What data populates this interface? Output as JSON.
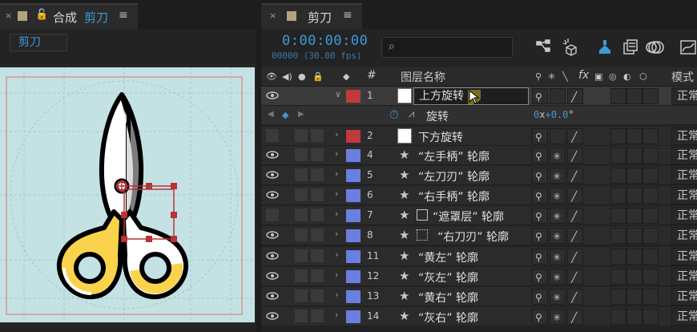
{
  "composition_panel": {
    "tab": {
      "close": "×",
      "prefix": "合成",
      "name": "剪刀",
      "menu": "≡"
    },
    "comp_name": "剪刀"
  },
  "timeline_panel": {
    "tab": {
      "close": "×",
      "name": "剪刀",
      "menu": "≡"
    },
    "timecode": "0:00:00:00",
    "frames": "00000 (30.00 fps)",
    "search": {
      "value": "",
      "placeholder": ""
    },
    "headers": {
      "layer_num": "#",
      "layer_name": "图层名称",
      "fx": "fx",
      "mode": "模式"
    },
    "layers": [
      {
        "num": "1",
        "name": "上方旋转",
        "label_color": "#c0393c",
        "source": "solid",
        "visible": true,
        "selected": true,
        "editing": true
      },
      {
        "num": "2",
        "name": "下方旋转",
        "label_color": "#c0393c",
        "source": "solid",
        "visible": false
      },
      {
        "num": "4",
        "name": "“左手柄” 轮廓",
        "label_color": "#6b7fe0",
        "source": "shape",
        "visible": true
      },
      {
        "num": "5",
        "name": "“左刀刃” 轮廓",
        "label_color": "#6b7fe0",
        "source": "shape",
        "visible": true
      },
      {
        "num": "6",
        "name": "“右手柄” 轮廓",
        "label_color": "#6b7fe0",
        "source": "shape",
        "visible": true
      },
      {
        "num": "7",
        "name": "“遮罩层” 轮廓",
        "label_color": "#6b7fe0",
        "source": "shape-masked",
        "visible": false
      },
      {
        "num": "8",
        "name": "“右刀刃” 轮廓",
        "label_color": "#6b7fe0",
        "source": "shape-masked",
        "visible": true
      },
      {
        "num": "11",
        "name": "“黄左” 轮廓",
        "label_color": "#6b7fe0",
        "source": "shape",
        "visible": true
      },
      {
        "num": "12",
        "name": "“灰左” 轮廓",
        "label_color": "#6b7fe0",
        "source": "shape",
        "visible": true
      },
      {
        "num": "13",
        "name": "“黄右” 轮廓",
        "label_color": "#6b7fe0",
        "source": "shape",
        "visible": true
      },
      {
        "num": "14",
        "name": "“灰右” 轮廓",
        "label_color": "#6b7fe0",
        "source": "shape",
        "visible": true
      }
    ],
    "property": {
      "name": "旋转",
      "value_turns": "0",
      "value_x": "x",
      "value_deg": "+0.0",
      "deg_symbol": "°"
    },
    "mode_value": "正常"
  },
  "colors": {
    "accent": "#3e9ad8",
    "canvas_bg": "#c4e2e4",
    "scissor_yellow": "#f9d34b",
    "red_label": "#c0393c",
    "blue_label": "#6b7fe0"
  }
}
